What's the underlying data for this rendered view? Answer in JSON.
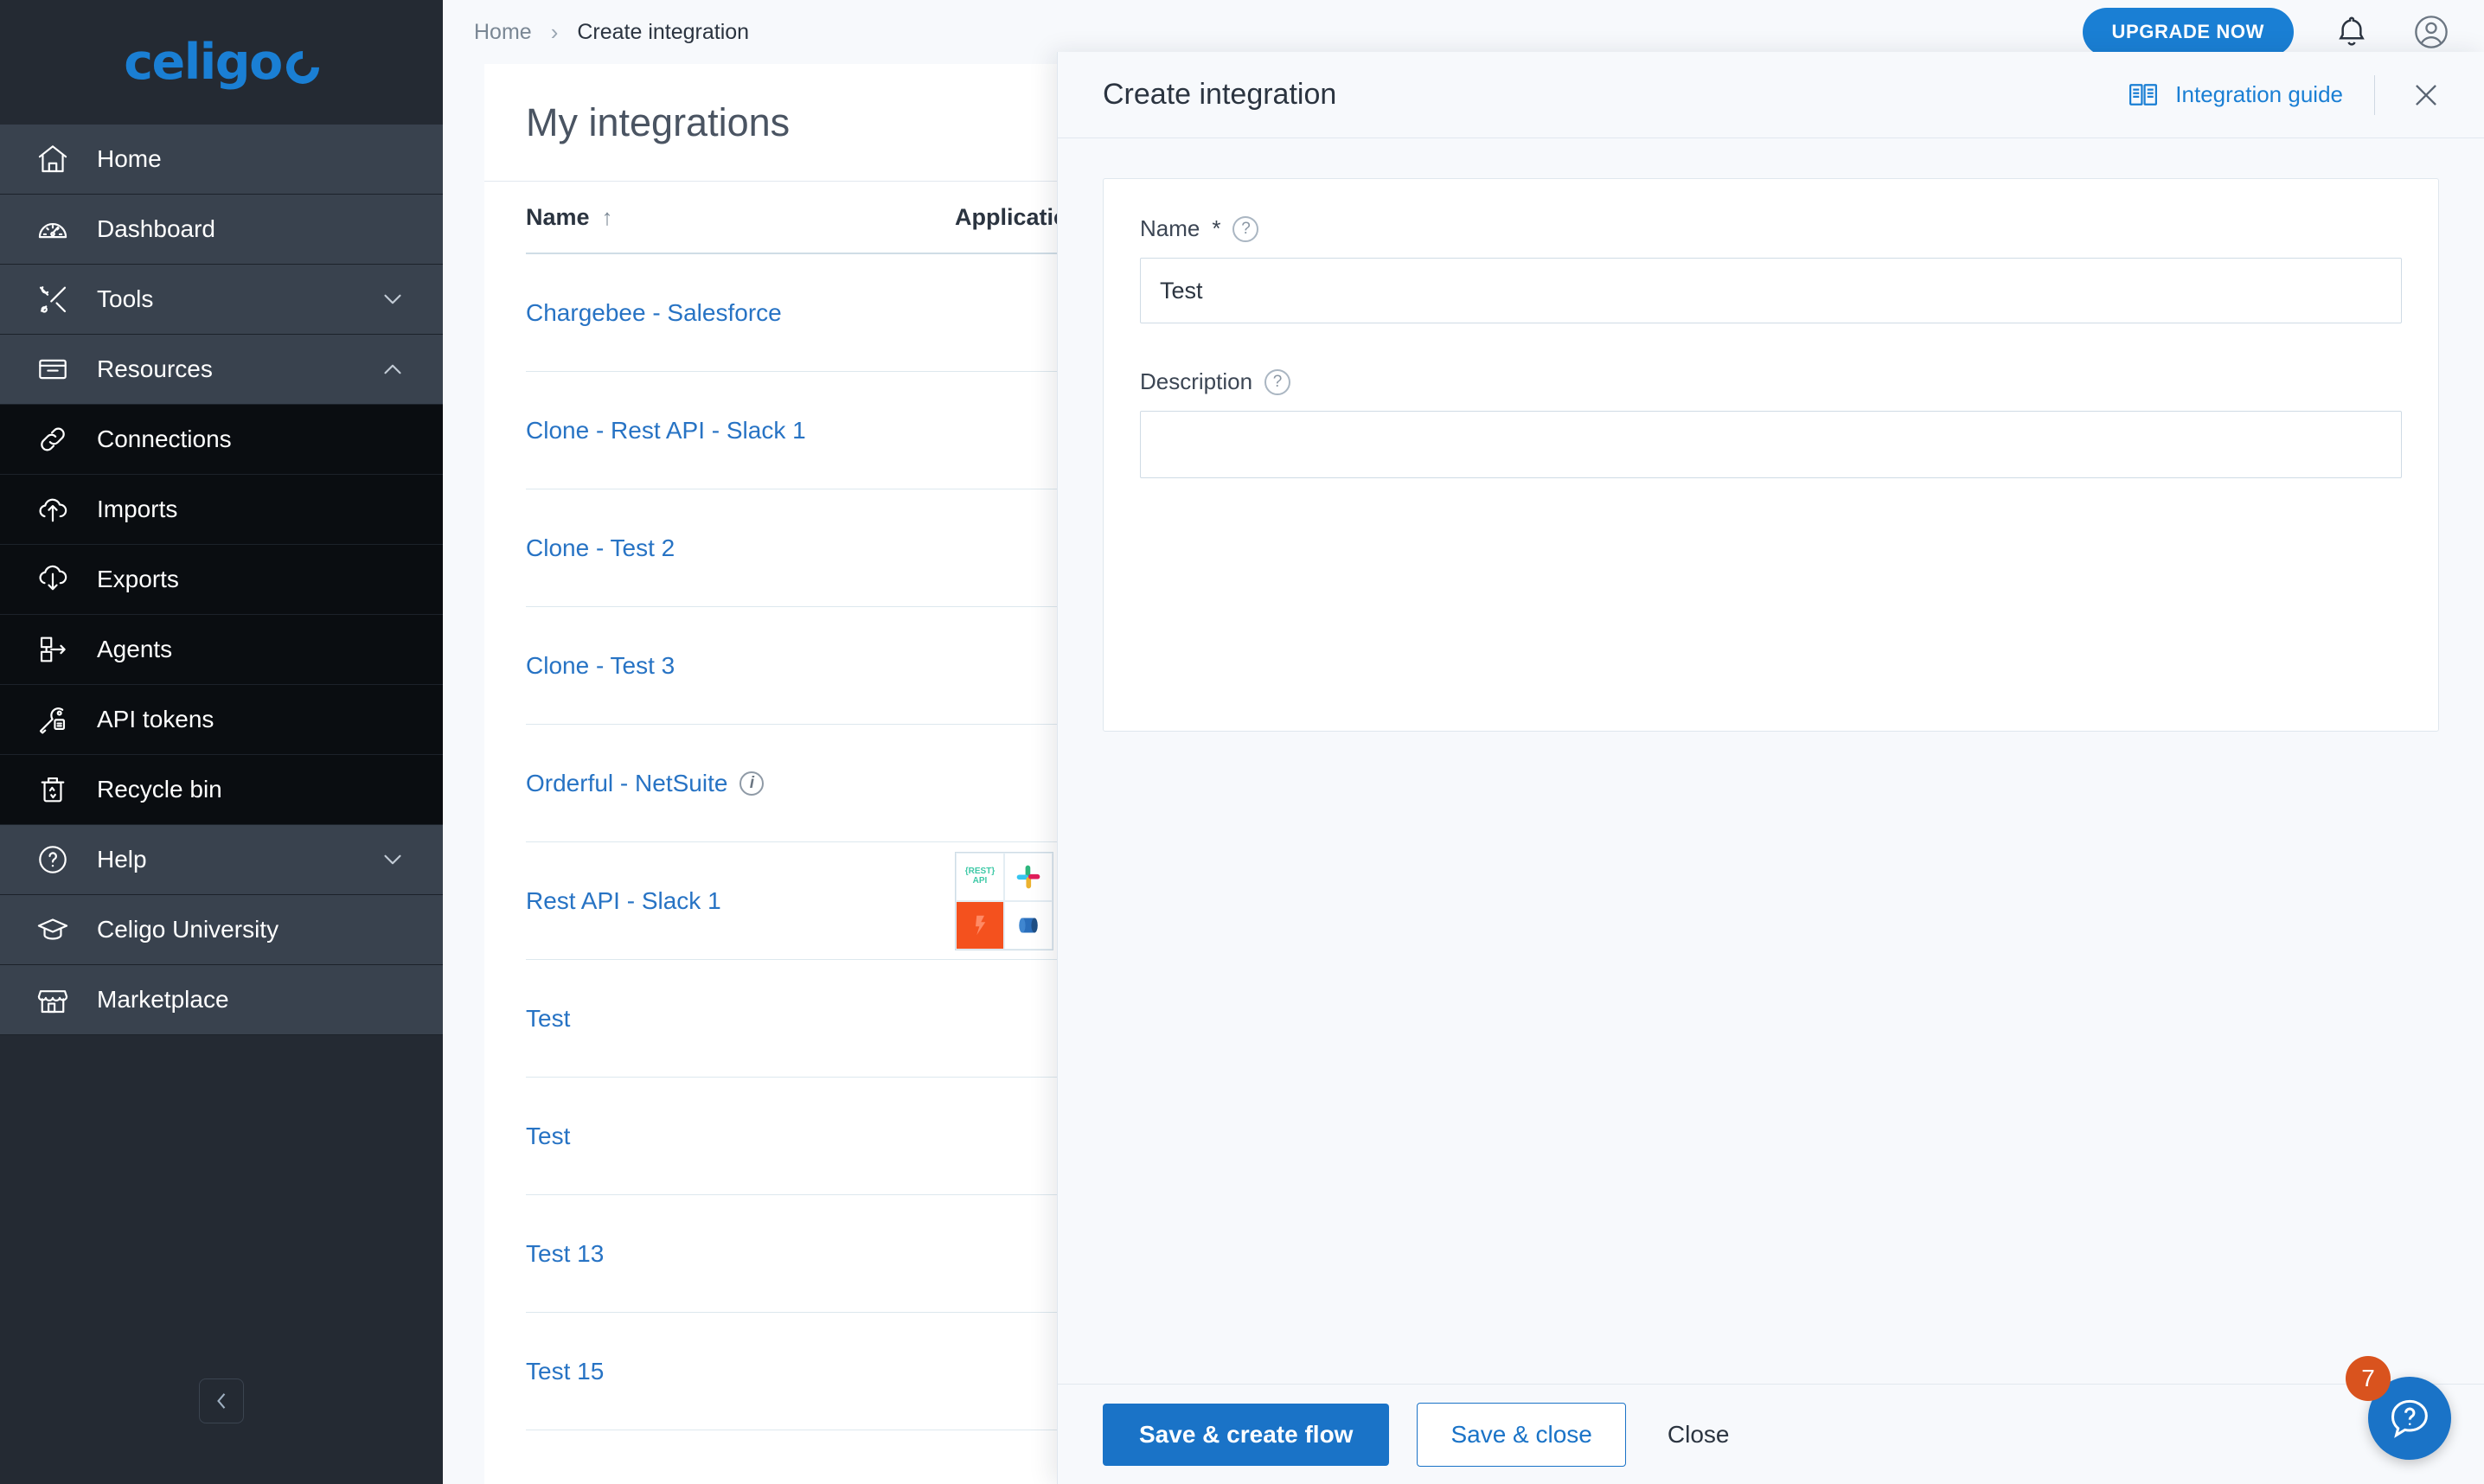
{
  "brand": {
    "logo_text": "celigo",
    "accent": "#1a7fd4"
  },
  "sidebar": {
    "items": [
      {
        "label": "Home",
        "icon": "home-icon",
        "level": "top",
        "chevron": ""
      },
      {
        "label": "Dashboard",
        "icon": "gauge-icon",
        "level": "top",
        "chevron": ""
      },
      {
        "label": "Tools",
        "icon": "tools-icon",
        "level": "top",
        "chevron": "down"
      },
      {
        "label": "Resources",
        "icon": "box-icon",
        "level": "top",
        "chevron": "up"
      },
      {
        "label": "Connections",
        "icon": "link-icon",
        "level": "sub",
        "chevron": ""
      },
      {
        "label": "Imports",
        "icon": "cloud-up-icon",
        "level": "sub",
        "chevron": ""
      },
      {
        "label": "Exports",
        "icon": "cloud-down-icon",
        "level": "sub",
        "chevron": ""
      },
      {
        "label": "Agents",
        "icon": "agent-icon",
        "level": "sub",
        "chevron": ""
      },
      {
        "label": "API tokens",
        "icon": "key-icon",
        "level": "sub",
        "chevron": ""
      },
      {
        "label": "Recycle bin",
        "icon": "recycle-bin-icon",
        "level": "sub",
        "chevron": ""
      },
      {
        "label": "Help",
        "icon": "question-icon",
        "level": "top",
        "chevron": "down"
      },
      {
        "label": "Celigo University",
        "icon": "graduation-icon",
        "level": "top",
        "chevron": ""
      },
      {
        "label": "Marketplace",
        "icon": "storefront-icon",
        "level": "top",
        "chevron": ""
      }
    ],
    "collapse_icon": "chevron-left-icon"
  },
  "topbar": {
    "breadcrumb": {
      "home": "Home",
      "separator": "›",
      "current": "Create integration"
    },
    "upgrade_label": "UPGRADE NOW",
    "bell_icon": "bell-icon",
    "account_icon": "account-circle-icon"
  },
  "main": {
    "page_title": "My integrations",
    "columns": [
      {
        "label": "Name",
        "sort": "↑"
      },
      {
        "label": "Applications"
      }
    ],
    "rows": [
      {
        "name": "Chargebee - Salesforce",
        "info": false,
        "apps": []
      },
      {
        "name": "Clone - Rest API - Slack 1",
        "info": false,
        "apps": []
      },
      {
        "name": "Clone - Test 2",
        "info": false,
        "apps": []
      },
      {
        "name": "Clone - Test 3",
        "info": false,
        "apps": []
      },
      {
        "name": "Orderful - NetSuite",
        "info": true,
        "apps": []
      },
      {
        "name": "Rest API - Slack 1",
        "info": false,
        "apps": [
          "rest-api-icon",
          "slack-icon",
          "netsuite-icon",
          "mongodb-icon"
        ]
      },
      {
        "name": "Test",
        "info": false,
        "apps": []
      },
      {
        "name": "Test",
        "info": false,
        "apps": []
      },
      {
        "name": "Test 13",
        "info": false,
        "apps": []
      },
      {
        "name": "Test 15",
        "info": false,
        "apps": []
      }
    ],
    "app_tile_labels": {
      "rest_api": "{REST} API"
    }
  },
  "modal": {
    "title": "Create integration",
    "guide_label": "Integration guide",
    "guide_icon": "book-icon",
    "close_icon": "close-icon",
    "fields": {
      "name": {
        "label": "Name",
        "required_mark": "*",
        "help_icon": "question-circle-icon",
        "value": "Test",
        "placeholder": ""
      },
      "description": {
        "label": "Description",
        "help_icon": "question-circle-icon",
        "value": "",
        "placeholder": ""
      }
    },
    "buttons": {
      "primary": "Save & create flow",
      "secondary": "Save & close",
      "tertiary": "Close"
    }
  },
  "fab": {
    "icon": "help-chat-icon",
    "badge": "7",
    "badge_color": "#d9531e",
    "color": "#1a73c7"
  }
}
